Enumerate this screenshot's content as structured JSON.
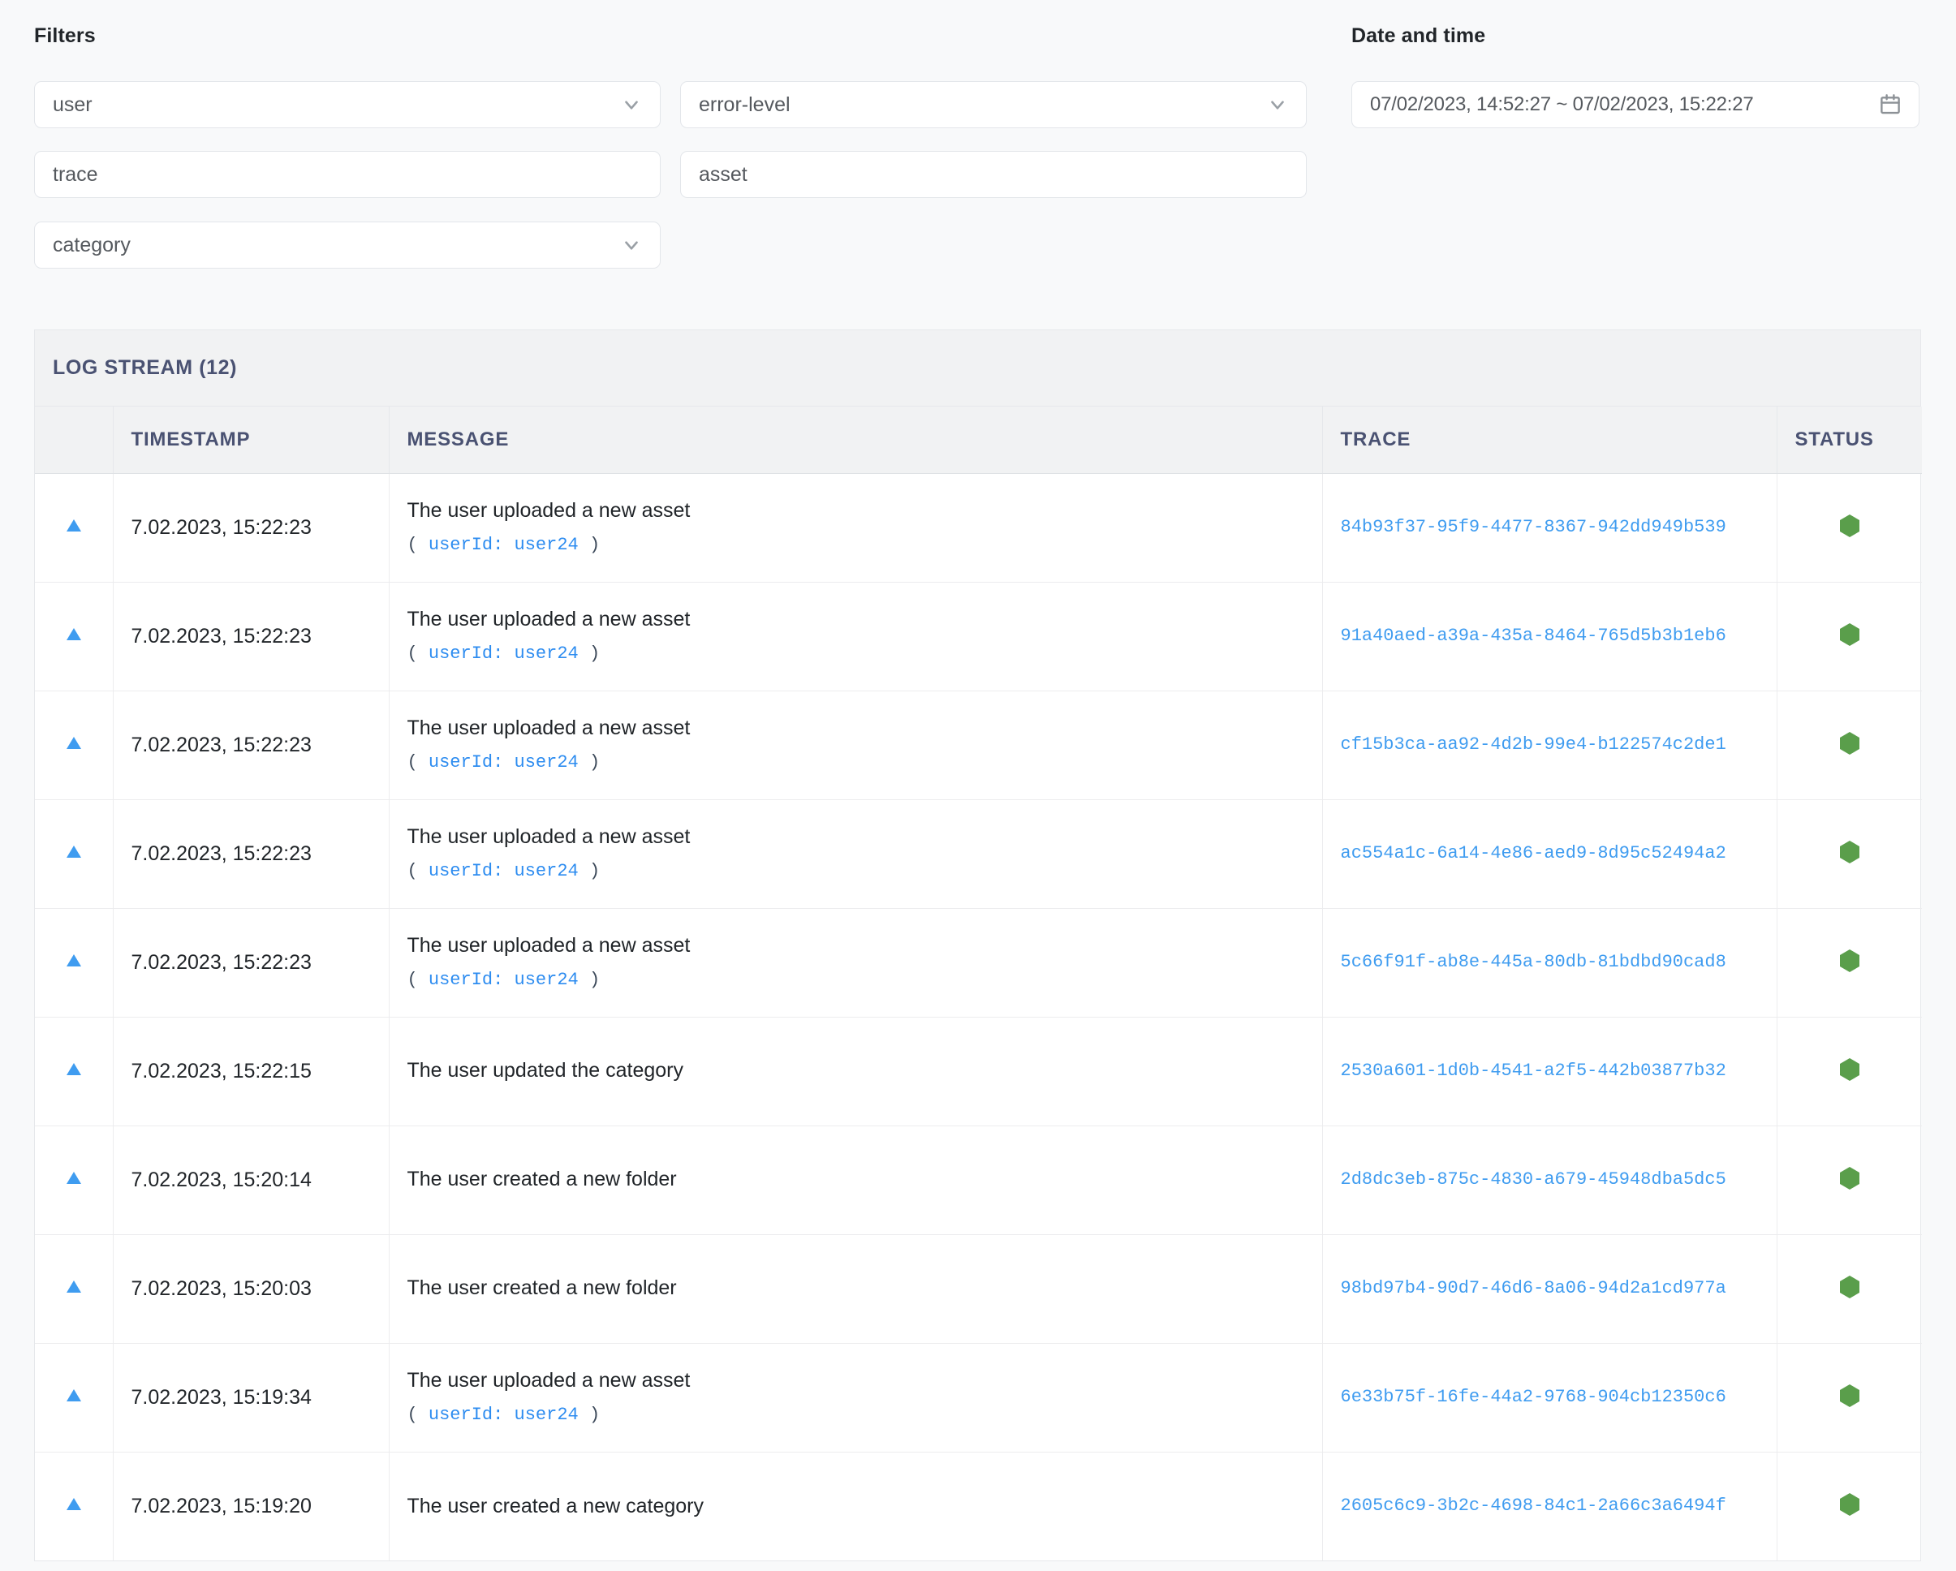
{
  "filters": {
    "title": "Filters",
    "fields": [
      {
        "name": "user",
        "value": "user",
        "type": "select",
        "icon": "chevron-down-icon"
      },
      {
        "name": "error-level",
        "value": "error-level",
        "type": "select",
        "icon": "chevron-down-icon"
      },
      {
        "name": "trace",
        "value": "trace",
        "type": "input",
        "icon": ""
      },
      {
        "name": "asset",
        "value": "asset",
        "type": "input",
        "icon": ""
      },
      {
        "name": "category",
        "value": "category",
        "type": "select",
        "icon": "chevron-down-icon"
      }
    ]
  },
  "datetime": {
    "title": "Date and time",
    "value": "07/02/2023, 14:52:27 ~ 07/02/2023, 15:22:27",
    "icon": "calendar-icon"
  },
  "log_stream": {
    "title": "LOG STREAM (12)",
    "columns": [
      "",
      "TIMESTAMP",
      "MESSAGE",
      "TRACE",
      "STATUS"
    ],
    "rows": [
      {
        "timestamp": "7.02.2023, 15:22:23",
        "message": "The user uploaded a new asset",
        "meta_key": "userId:",
        "meta_value": "user24",
        "trace": "84b93f37-95f9-4477-8367-942dd949b539",
        "status": "ok"
      },
      {
        "timestamp": "7.02.2023, 15:22:23",
        "message": "The user uploaded a new asset",
        "meta_key": "userId:",
        "meta_value": "user24",
        "trace": "91a40aed-a39a-435a-8464-765d5b3b1eb6",
        "status": "ok"
      },
      {
        "timestamp": "7.02.2023, 15:22:23",
        "message": "The user uploaded a new asset",
        "meta_key": "userId:",
        "meta_value": "user24",
        "trace": "cf15b3ca-aa92-4d2b-99e4-b122574c2de1",
        "status": "ok"
      },
      {
        "timestamp": "7.02.2023, 15:22:23",
        "message": "The user uploaded a new asset",
        "meta_key": "userId:",
        "meta_value": "user24",
        "trace": "ac554a1c-6a14-4e86-aed9-8d95c52494a2",
        "status": "ok"
      },
      {
        "timestamp": "7.02.2023, 15:22:23",
        "message": "The user uploaded a new asset",
        "meta_key": "userId:",
        "meta_value": "user24",
        "trace": "5c66f91f-ab8e-445a-80db-81bdbd90cad8",
        "status": "ok"
      },
      {
        "timestamp": "7.02.2023, 15:22:15",
        "message": "The user updated the category",
        "meta_key": "",
        "meta_value": "",
        "trace": "2530a601-1d0b-4541-a2f5-442b03877b32",
        "status": "ok"
      },
      {
        "timestamp": "7.02.2023, 15:20:14",
        "message": "The user created a new folder",
        "meta_key": "",
        "meta_value": "",
        "trace": "2d8dc3eb-875c-4830-a679-45948dba5dc5",
        "status": "ok"
      },
      {
        "timestamp": "7.02.2023, 15:20:03",
        "message": "The user created a new folder",
        "meta_key": "",
        "meta_value": "",
        "trace": "98bd97b4-90d7-46d6-8a06-94d2a1cd977a",
        "status": "ok"
      },
      {
        "timestamp": "7.02.2023, 15:19:34",
        "message": "The user uploaded a new asset",
        "meta_key": "userId:",
        "meta_value": "user24",
        "trace": "6e33b75f-16fe-44a2-9768-904cb12350c6",
        "status": "ok"
      },
      {
        "timestamp": "7.02.2023, 15:19:20",
        "message": "The user created a new category",
        "meta_key": "",
        "meta_value": "",
        "trace": "2605c6c9-3b2c-4698-84c1-2a66c3a6494f",
        "status": "ok"
      }
    ],
    "expand_icon": "triangle-up-icon",
    "status_icon": "hexagon-icon"
  },
  "colors": {
    "status_ok": "#5a9e4b",
    "link": "#3f9cf0",
    "expand_triangle": "#3f9cf0",
    "header_text": "#4a5272",
    "page_bg": "#f8f9fa",
    "card_header_bg": "#f1f2f3"
  }
}
